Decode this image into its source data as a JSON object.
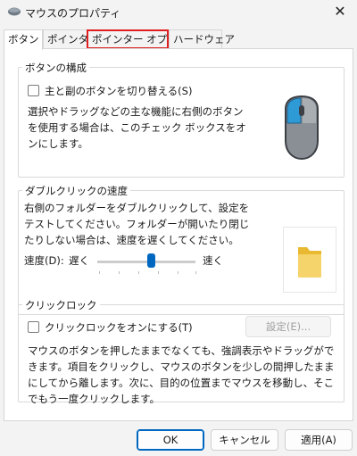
{
  "window": {
    "title": "マウスのプロパティ",
    "close_glyph": "✕"
  },
  "tabs": [
    {
      "label": "ボタン",
      "active": true
    },
    {
      "label": "ポインター"
    },
    {
      "label": "ポインター オプション",
      "highlight_color": "#e02020"
    },
    {
      "label": "ハードウェア"
    }
  ],
  "button_config": {
    "title": "ボタンの構成",
    "checkbox_label": "主と副のボタンを切り替える(S)",
    "description": "選択やドラッグなどの主な機能に右側のボタンを使用する場合は、このチェック ボックスをオンにします。"
  },
  "double_click": {
    "title": "ダブルクリックの速度",
    "description": "右側のフォルダーをダブルクリックして、設定をテストしてください。フォルダーが開いたり閉じたりしない場合は、速度を遅くしてください。",
    "speed_label": "速度(D):",
    "slow_label": "遅く",
    "fast_label": "速く",
    "speed_fraction": 0.55
  },
  "click_lock": {
    "title": "クリックロック",
    "checkbox_label": "クリックロックをオンにする(T)",
    "settings_button": "設定(E)...",
    "description": "マウスのボタンを押したままでなくても、強調表示やドラッグができます。項目をクリックし、マウスのボタンを少しの間押したままにしてから離します。次に、目的の位置までマウスを移動し、そこでもう一度クリックします。"
  },
  "footer": {
    "ok": "OK",
    "cancel": "キャンセル",
    "apply": "適用(A)"
  },
  "colors": {
    "accent": "#0067c0"
  }
}
